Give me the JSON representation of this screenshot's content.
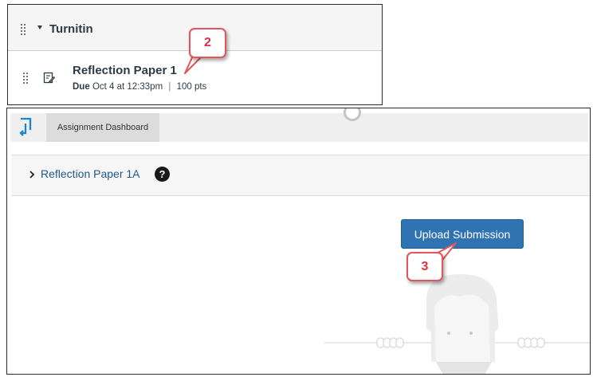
{
  "module": {
    "title": "Turnitin",
    "item": {
      "title": "Reflection Paper 1",
      "due_label": "Due",
      "due_date": "Oct 4 at 12:33pm",
      "separator": "|",
      "points": "100 pts"
    }
  },
  "callouts": [
    {
      "label": "2"
    },
    {
      "label": "3"
    }
  ],
  "turnitin": {
    "tab_label": "Assignment Dashboard",
    "assignment_title": "Reflection Paper 1A",
    "help_glyph": "?",
    "upload_button": "Upload Submission"
  },
  "icons": {
    "drag": "drag-handle-icon",
    "caret": "caret-down-icon",
    "assignment": "assignment-icon",
    "logo": "turnitin-logo-icon",
    "chevron": "chevron-right-icon",
    "help": "help-icon",
    "spinner": "loading-spinner-icon"
  },
  "colors": {
    "callout_border": "#e0565b",
    "callout_text": "#d9333f",
    "button_bg": "#2f73b3",
    "link": "#1f5a8c"
  }
}
